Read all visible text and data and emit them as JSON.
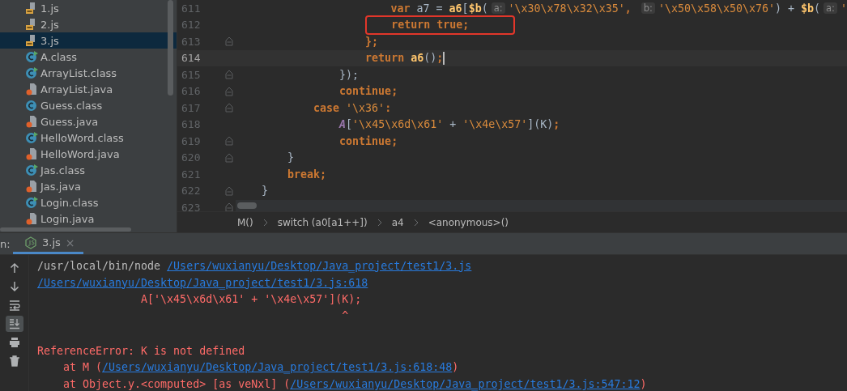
{
  "project_tree": {
    "items": [
      {
        "name": "1.js",
        "kind": "js",
        "selected": false
      },
      {
        "name": "2.js",
        "kind": "js",
        "selected": false
      },
      {
        "name": "3.js",
        "kind": "js",
        "selected": true
      },
      {
        "name": "A.class",
        "kind": "runclass",
        "selected": false
      },
      {
        "name": "ArrayList.class",
        "kind": "runclass",
        "selected": false
      },
      {
        "name": "ArrayList.java",
        "kind": "java",
        "selected": false
      },
      {
        "name": "Guess.class",
        "kind": "class",
        "selected": false
      },
      {
        "name": "Guess.java",
        "kind": "java",
        "selected": false
      },
      {
        "name": "HelloWord.class",
        "kind": "runclass",
        "selected": false
      },
      {
        "name": "HelloWord.java",
        "kind": "java",
        "selected": false
      },
      {
        "name": "Jas.class",
        "kind": "runclass",
        "selected": false
      },
      {
        "name": "Jas.java",
        "kind": "java",
        "selected": false
      },
      {
        "name": "Login.class",
        "kind": "runclass",
        "selected": false
      },
      {
        "name": "Login.java",
        "kind": "java",
        "selected": false
      }
    ]
  },
  "editor": {
    "lines": [
      {
        "number": "611",
        "fold": false,
        "current": false,
        "tokens": [
          {
            "t": "                        var",
            "kind": "kw"
          },
          {
            "t": " a7 = ",
            "kind": "plain"
          },
          {
            "t": "a6",
            "kind": "fn"
          },
          {
            "t": "[",
            "kind": "plain"
          },
          {
            "t": "$b",
            "kind": "fn"
          },
          {
            "t": "(",
            "kind": "plain"
          },
          {
            "t": "a:",
            "kind": "hint"
          },
          {
            "t": "'\\x30\\x78\\x32\\x35'",
            "kind": "str"
          },
          {
            "t": ", ",
            "kind": "kw"
          },
          {
            "t": "b:",
            "kind": "hint"
          },
          {
            "t": "'\\x50\\x58\\x50\\x76'",
            "kind": "str"
          },
          {
            "t": ") + ",
            "kind": "plain"
          },
          {
            "t": "$b",
            "kind": "fn"
          },
          {
            "t": "(",
            "kind": "plain"
          },
          {
            "t": "a:",
            "kind": "hint"
          },
          {
            "t": "'",
            "kind": "str"
          }
        ]
      },
      {
        "number": "612",
        "fold": false,
        "current": false,
        "tokens": [
          {
            "t": "                        return true;",
            "kind": "kw"
          }
        ]
      },
      {
        "number": "613",
        "fold": true,
        "current": false,
        "tokens": [
          {
            "t": "                    };",
            "kind": "kw"
          }
        ]
      },
      {
        "number": "614",
        "fold": false,
        "current": true,
        "tokens": [
          {
            "t": "                    return ",
            "kind": "kw"
          },
          {
            "t": "a6",
            "kind": "fn"
          },
          {
            "t": "()",
            "kind": "plain"
          },
          {
            "t": ";",
            "kind": "kw"
          }
        ]
      },
      {
        "number": "615",
        "fold": true,
        "current": false,
        "tokens": [
          {
            "t": "                });",
            "kind": "plain"
          }
        ]
      },
      {
        "number": "616",
        "fold": true,
        "current": false,
        "tokens": [
          {
            "t": "                continue;",
            "kind": "kw"
          }
        ]
      },
      {
        "number": "617",
        "fold": true,
        "current": false,
        "tokens": [
          {
            "t": "            case ",
            "kind": "kw"
          },
          {
            "t": "'\\x36'",
            "kind": "str"
          },
          {
            "t": ":",
            "kind": "kw"
          }
        ]
      },
      {
        "number": "618",
        "fold": false,
        "current": false,
        "tokens": [
          {
            "t": "                A",
            "kind": "cls"
          },
          {
            "t": "[",
            "kind": "plain"
          },
          {
            "t": "'\\x45\\x6d\\x61'",
            "kind": "str"
          },
          {
            "t": " + ",
            "kind": "plain"
          },
          {
            "t": "'\\x4e\\x57'",
            "kind": "str"
          },
          {
            "t": "](K)",
            "kind": "plain"
          },
          {
            "t": ";",
            "kind": "kw"
          }
        ]
      },
      {
        "number": "619",
        "fold": true,
        "current": false,
        "tokens": [
          {
            "t": "                continue;",
            "kind": "kw"
          }
        ]
      },
      {
        "number": "620",
        "fold": true,
        "current": false,
        "tokens": [
          {
            "t": "        }",
            "kind": "plain"
          }
        ]
      },
      {
        "number": "621",
        "fold": false,
        "current": false,
        "tokens": [
          {
            "t": "        break;",
            "kind": "kw"
          }
        ]
      },
      {
        "number": "622",
        "fold": true,
        "current": false,
        "tokens": [
          {
            "t": "    }",
            "kind": "plain"
          }
        ]
      },
      {
        "number": "623",
        "fold": true,
        "current": false
      }
    ]
  },
  "breadcrumbs": [
    "M()",
    "switch (a0[a1++])",
    "a4",
    "<anonymous>()"
  ],
  "run_panel": {
    "label": "n:",
    "tabs": [
      {
        "label": "3.js",
        "close": "×",
        "selected": true
      }
    ],
    "tools": [
      {
        "kind": "up",
        "on": false
      },
      {
        "kind": "down",
        "on": false
      },
      {
        "kind": "wrap",
        "on": false
      },
      {
        "kind": "scrollend",
        "on": true
      },
      {
        "kind": "print",
        "on": false
      },
      {
        "kind": "trash",
        "on": false
      }
    ],
    "console": [
      {
        "segments": [
          {
            "t": "/usr/local/bin/node ",
            "kind": "plain"
          },
          {
            "t": "/Users/wuxianyu/Desktop/Java_project/test1/3.js",
            "kind": "link"
          }
        ]
      },
      {
        "segments": [
          {
            "t": "/Users/wuxianyu/Desktop/Java_project/test1/3.js:618",
            "kind": "link"
          }
        ]
      },
      {
        "segments": [
          {
            "t": "                A['\\x45\\x6d\\x61' + '\\x4e\\x57'](K);",
            "kind": "error"
          }
        ]
      },
      {
        "segments": [
          {
            "t": "                                               ^",
            "kind": "error"
          }
        ]
      },
      {
        "segments": [
          {
            "t": "ReferenceError: K is not defined",
            "kind": "error"
          }
        ]
      },
      {
        "segments": [
          {
            "t": "    at M (",
            "kind": "error"
          },
          {
            "t": "/Users/wuxianyu/Desktop/Java_project/test1/3.js:618:48",
            "kind": "link"
          },
          {
            "t": ")",
            "kind": "error"
          }
        ]
      },
      {
        "segments": [
          {
            "t": "    at Object.y.<computed> [as veNxl] (",
            "kind": "error"
          },
          {
            "t": "/Users/wuxianyu/Desktop/Java_project/test1/3.js:547:12",
            "kind": "link"
          },
          {
            "t": ")",
            "kind": "error"
          }
        ]
      }
    ]
  }
}
